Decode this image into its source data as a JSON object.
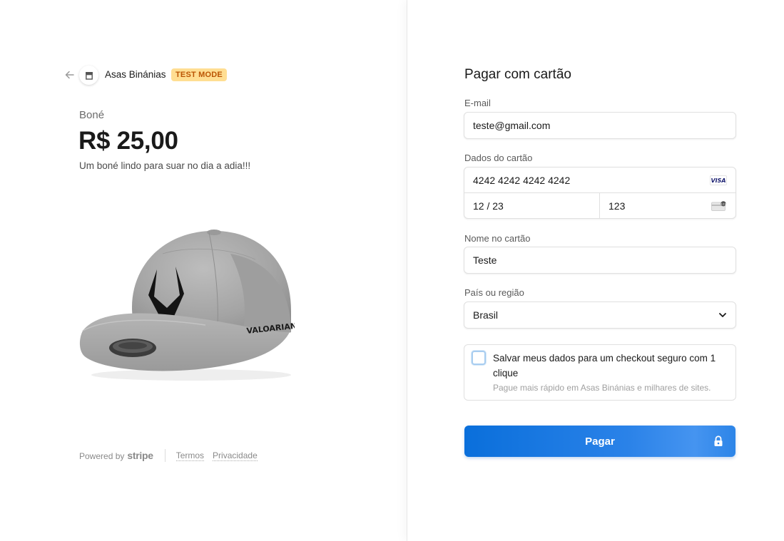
{
  "merchant": {
    "name": "Asas Binánias",
    "badge": "TEST MODE",
    "back_icon": "arrow-left-icon",
    "store_icon": "store-icon"
  },
  "product": {
    "name": "Boné",
    "price": "R$ 25,00",
    "description": "Um boné lindo para suar no dia a adia!!!",
    "image": "cap-image",
    "image_brand_text": "VALOARIAN"
  },
  "footer": {
    "powered_by": "Powered by",
    "stripe": "stripe",
    "terms": "Termos",
    "privacy": "Privacidade"
  },
  "form": {
    "title": "Pagar com cartão",
    "email": {
      "label": "E-mail",
      "value": "teste@gmail.com"
    },
    "card": {
      "label": "Dados do cartão",
      "number": "4242 4242 4242 4242",
      "brand": "VISA",
      "expiry": "12 / 23",
      "cvc": "123",
      "cvc_icon": "cvc-card-icon"
    },
    "name": {
      "label": "Nome no cartão",
      "value": "Teste"
    },
    "country": {
      "label": "País ou região",
      "value": "Brasil",
      "icon": "chevron-down-icon"
    },
    "save": {
      "checked": false,
      "title": "Salvar meus dados para um checkout seguro com 1 clique",
      "subtitle": "Pague mais rápido em Asas Binánias e milhares de sites."
    },
    "pay_button": {
      "label": "Pagar",
      "icon": "lock-icon"
    }
  },
  "colors": {
    "accent": "#0a6fdb",
    "badge_bg": "#ffde92",
    "badge_text": "#bb5504"
  }
}
